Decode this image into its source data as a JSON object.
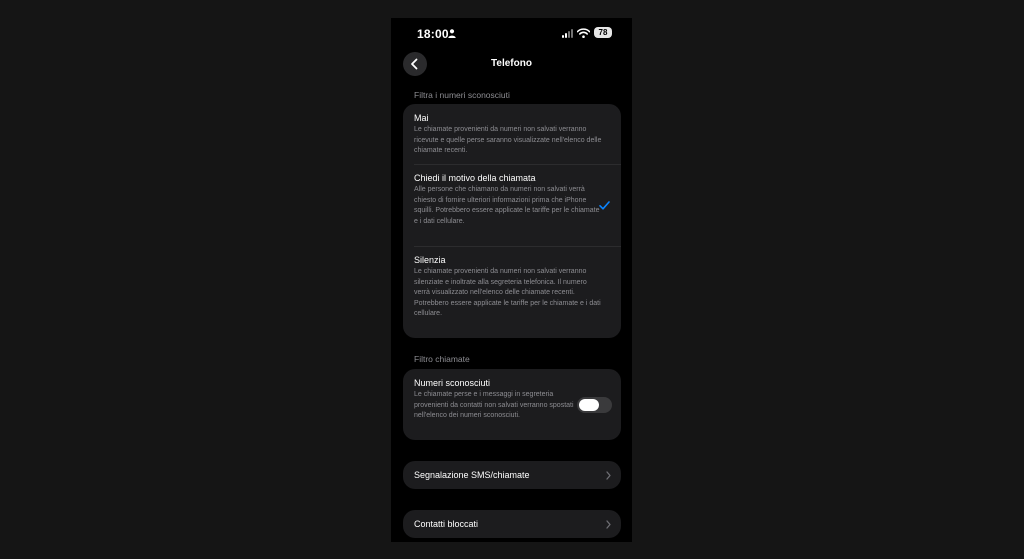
{
  "status_bar": {
    "time": "18:00",
    "battery": "78"
  },
  "nav": {
    "title": "Telefono"
  },
  "unknown_filter": {
    "header": "Filtra i numeri sconosciuti",
    "options": [
      {
        "title": "Mai",
        "desc": "Le chiamate provenienti da numeri non salvati verranno ricevute e quelle perse saranno visualizzate nell'elenco delle chiamate recenti.",
        "selected": false
      },
      {
        "title": "Chiedi il motivo della chiamata",
        "desc": "Alle persone che chiamano da numeri non salvati verrà chiesto di fornire ulteriori informazioni prima che iPhone squilli. Potrebbero essere applicate le tariffe per le chiamate e i dati cellulare.",
        "selected": true
      },
      {
        "title": "Silenzia",
        "desc": "Le chiamate provenienti da numeri non salvati verranno silenziate e inoltrate alla segreteria telefonica. Il numero verrà visualizzato nell'elenco delle chiamate recenti. Potrebbero essere applicate le tariffe per le chiamate e i dati cellulare.",
        "selected": false
      }
    ]
  },
  "call_filter": {
    "header": "Filtro chiamate",
    "title": "Numeri sconosciuti",
    "desc": "Le chiamate perse e i messaggi in segreteria provenienti da contatti non salvati verranno spostati nell'elenco dei numeri sconosciuti.",
    "toggle_on": false
  },
  "rows": {
    "sms_report": "Segnalazione SMS/chiamate",
    "blocked": "Contatti bloccati"
  },
  "colors": {
    "accent": "#0a84ff",
    "cell_bg": "#1c1c1e",
    "secondary_text": "#8d8d92"
  },
  "icons": [
    "person-icon",
    "signal-icon",
    "wifi-icon",
    "back-chevron-icon",
    "checkmark-icon",
    "chevron-right-icon"
  ]
}
